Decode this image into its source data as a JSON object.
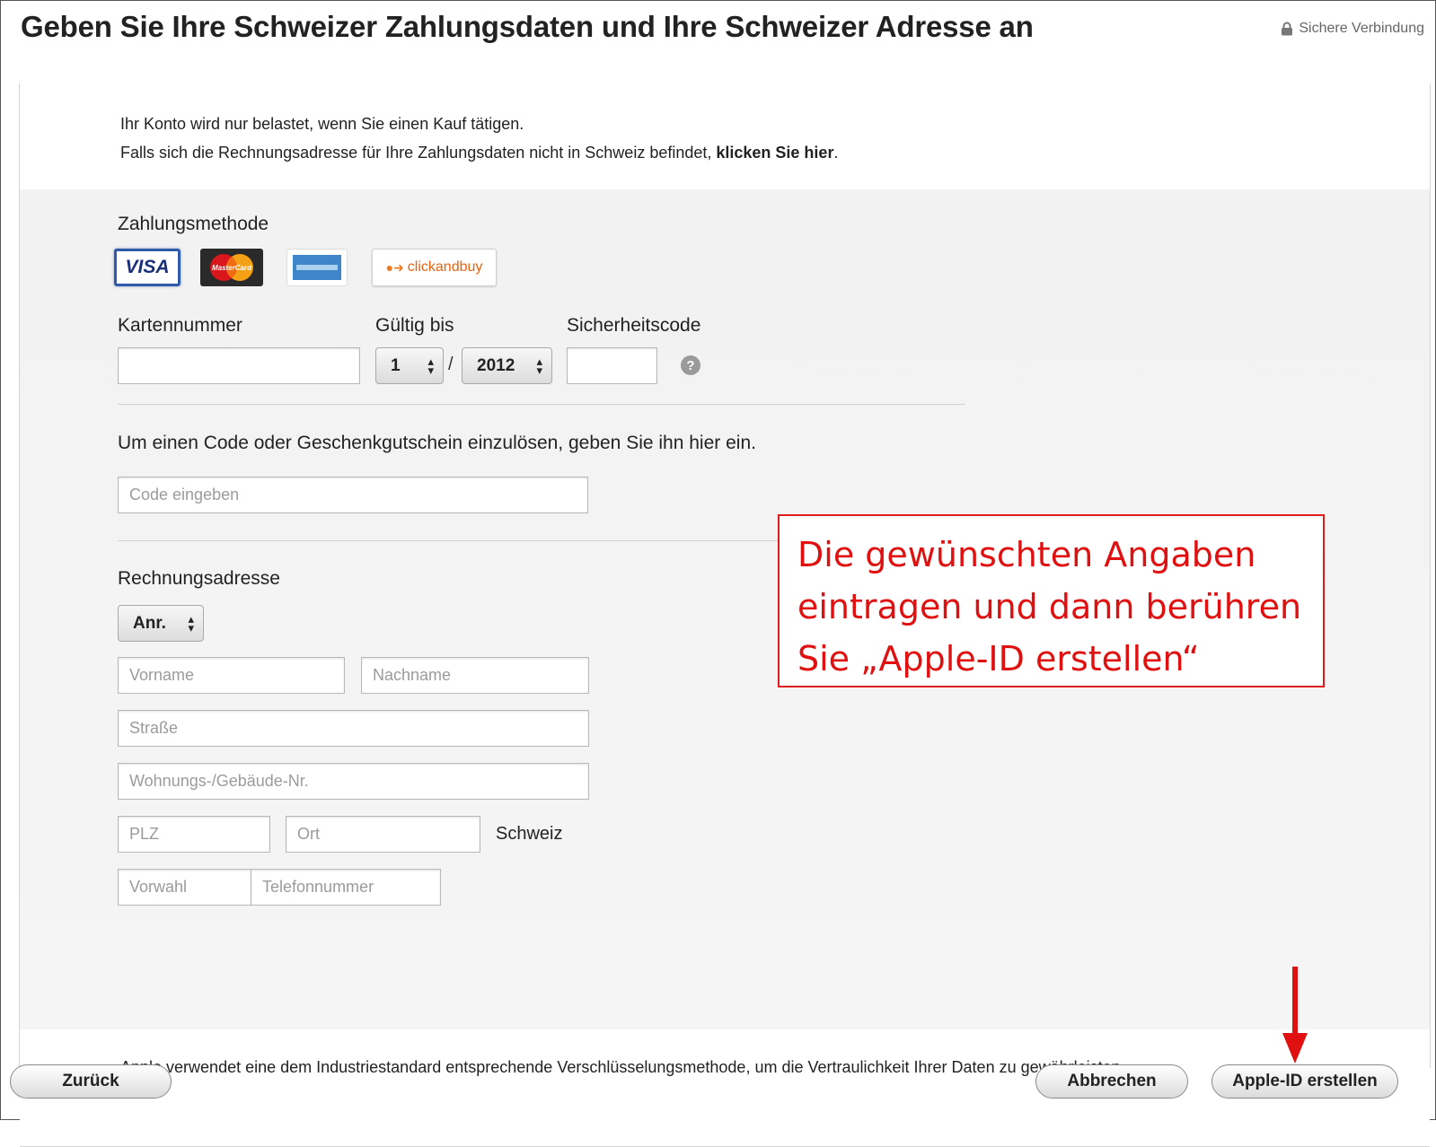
{
  "header": {
    "title": "Geben Sie Ihre Schweizer Zahlungsdaten und Ihre Schweizer Adresse an",
    "secure_label": "Sichere Verbindung"
  },
  "intro": {
    "line1": "Ihr Konto wird nur belastet, wenn Sie einen Kauf tätigen.",
    "line2_prefix": "Falls sich die Rechnungsadresse für Ihre Zahlungsdaten nicht in Schweiz befindet, ",
    "line2_link": "klicken Sie hier",
    "line2_suffix": "."
  },
  "payment": {
    "heading": "Zahlungsmethode",
    "methods": [
      {
        "name": "VISA",
        "selected": true
      },
      {
        "name": "MasterCard",
        "selected": false
      },
      {
        "name": "American Express",
        "selected": false
      },
      {
        "name": "clickandbuy",
        "selected": false
      }
    ],
    "card_number_label": "Kartennummer",
    "card_number_value": "",
    "expiry_label": "Gültig bis",
    "expiry_month": "1",
    "expiry_separator": "/",
    "expiry_year": "2012",
    "security_code_label": "Sicherheitscode",
    "security_code_value": "",
    "help_symbol": "?"
  },
  "redeem": {
    "text": "Um einen Code oder Geschenkgutschein einzulösen, geben Sie ihn hier ein.",
    "placeholder": "Code eingeben"
  },
  "billing": {
    "heading": "Rechnungsadresse",
    "salutation": "Anr.",
    "first_name_placeholder": "Vorname",
    "last_name_placeholder": "Nachname",
    "street_placeholder": "Straße",
    "apartment_placeholder": "Wohnungs-/Gebäude-Nr.",
    "zip_placeholder": "PLZ",
    "city_placeholder": "Ort",
    "country": "Schweiz",
    "area_code_placeholder": "Vorwahl",
    "phone_placeholder": "Telefonnummer"
  },
  "callout": {
    "line1": "Die gewünschten Angaben",
    "line2": "eintragen und dann berühren",
    "line3": "Sie „Apple-ID erstellen“",
    "color": "#e01010"
  },
  "footer_note": "Apple verwendet eine dem Industriestandard entsprechende Verschlüsselungsmethode, um die Vertraulichkeit Ihrer Daten zu gewährleisten.",
  "buttons": {
    "back": "Zurück",
    "cancel": "Abbrechen",
    "create": "Apple-ID erstellen"
  }
}
